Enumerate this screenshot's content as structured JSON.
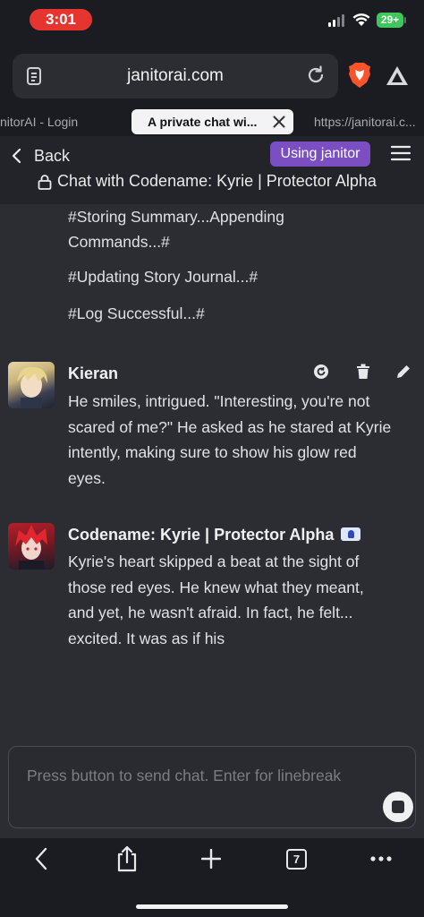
{
  "status": {
    "time": "3:01",
    "battery": "29+"
  },
  "browser": {
    "url": "janitorai.com",
    "tabs": [
      {
        "label": "nitorAI - Login"
      },
      {
        "label": "A private chat wi..."
      },
      {
        "label": "https://janitorai.c..."
      }
    ],
    "tab_count": "7"
  },
  "header": {
    "back_label": "Back",
    "badge": "Using janitor",
    "title": "Chat with Codename: Kyrie | Protector Alpha"
  },
  "system_lines": [
    "#Storing Summary...Appending",
    "Commands...#",
    "#Updating Story Journal...#",
    "#Log Successful...#"
  ],
  "messages": [
    {
      "name": "Kieran",
      "lines": [
        "He smiles, intrigued. \"Interesting, you're not",
        "scared of me?\" He asked as he stared at Kyrie",
        "intently, making sure to show his glow red",
        "eyes."
      ]
    },
    {
      "name": "Codename: Kyrie | Protector Alpha",
      "lines": [
        "Kyrie's heart skipped a beat at the sight of",
        "those red eyes. He knew what they meant,",
        "and yet, he wasn't afraid. In fact, he felt...",
        "excited. It was as if his"
      ]
    }
  ],
  "input": {
    "placeholder": "Press button to send chat. Enter for linebreak"
  },
  "icons": {
    "page": "page-icon",
    "reload": "reload-icon",
    "brave": "brave-lion-icon",
    "rewards": "triangle-rewards-icon",
    "close": "close-icon",
    "back": "chevron-left-icon",
    "menu": "hamburger-menu-icon",
    "lock": "lock-icon",
    "regenerate": "regenerate-icon",
    "delete": "trash-icon",
    "edit": "pencil-icon",
    "stop": "stop-icon",
    "share": "share-icon",
    "add": "plus-icon",
    "more": "more-dots-icon"
  },
  "colors": {
    "accent_badge": "#7b4fc2",
    "time_pill": "#e5352e",
    "battery": "#3ec75a"
  }
}
